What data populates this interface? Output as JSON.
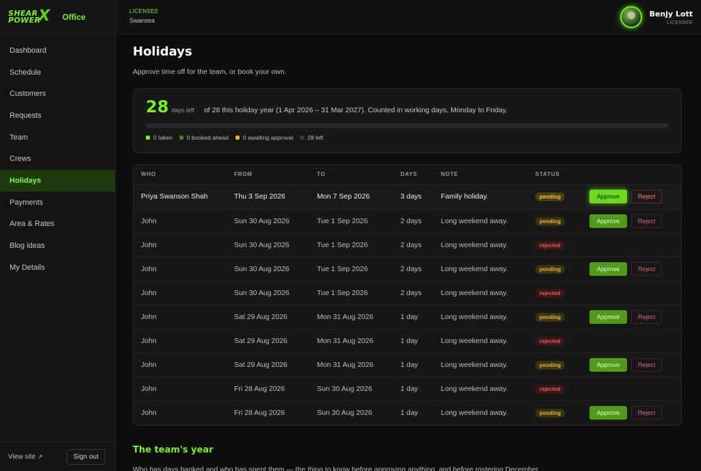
{
  "brand": {
    "line1": "SHEAR",
    "line2": "POWER",
    "x": "X",
    "office": "Office"
  },
  "topbar": {
    "licensee_label": "LICENSEE",
    "location": "Swansea",
    "user_name": "Benjy Lott",
    "user_role": "LICENSEE"
  },
  "nav": [
    {
      "label": "Dashboard",
      "active": false
    },
    {
      "label": "Schedule",
      "active": false
    },
    {
      "label": "Customers",
      "active": false
    },
    {
      "label": "Requests",
      "active": false
    },
    {
      "label": "Team",
      "active": false
    },
    {
      "label": "Crews",
      "active": false
    },
    {
      "label": "Holidays",
      "active": true
    },
    {
      "label": "Payments",
      "active": false
    },
    {
      "label": "Area & Rates",
      "active": false
    },
    {
      "label": "Blog ideas",
      "active": false
    },
    {
      "label": "My Details",
      "active": false
    }
  ],
  "footer": {
    "view_site": "View site",
    "view_site_icon": "↗",
    "sign_out": "Sign out"
  },
  "page": {
    "title": "Holidays",
    "subtitle": "Approve time off for the team, or book your own."
  },
  "balance": {
    "days_left": "28",
    "unit": "days left",
    "description": "of 28 this holiday year (1 Apr 2026 – 31 Mar 2027). Counted in working days, Monday to Friday.",
    "progress_used_fraction": 0,
    "legend": [
      {
        "label": "0 taken",
        "color": "#7cf21c"
      },
      {
        "label": "0 booked ahead",
        "color": "#3f8a14"
      },
      {
        "label": "0 awaiting approval",
        "color": "#e9b52c"
      },
      {
        "label": "28 left",
        "color": "#3a3a3a"
      }
    ]
  },
  "table": {
    "headers": {
      "who": "WHO",
      "from": "FROM",
      "to": "TO",
      "days": "DAYS",
      "note": "NOTE",
      "status": "STATUS"
    },
    "approve_label": "Approve",
    "reject_label": "Reject",
    "rows": [
      {
        "who": "Priya Swanson Shah",
        "from": "Thu 3 Sep 2026",
        "to": "Mon 7 Sep 2026",
        "days": "3 days",
        "note": "Family holiday.",
        "status": "pending"
      },
      {
        "who": "John",
        "from": "Sun 30 Aug 2026",
        "to": "Tue 1 Sep 2026",
        "days": "2 days",
        "note": "Long weekend away.",
        "status": "pending"
      },
      {
        "who": "John",
        "from": "Sun 30 Aug 2026",
        "to": "Tue 1 Sep 2026",
        "days": "2 days",
        "note": "Long weekend away.",
        "status": "rejected"
      },
      {
        "who": "John",
        "from": "Sun 30 Aug 2026",
        "to": "Tue 1 Sep 2026",
        "days": "2 days",
        "note": "Long weekend away.",
        "status": "pending"
      },
      {
        "who": "John",
        "from": "Sun 30 Aug 2026",
        "to": "Tue 1 Sep 2026",
        "days": "2 days",
        "note": "Long weekend away.",
        "status": "rejected"
      },
      {
        "who": "John",
        "from": "Sat 29 Aug 2026",
        "to": "Mon 31 Aug 2026",
        "days": "1 day",
        "note": "Long weekend away.",
        "status": "pending"
      },
      {
        "who": "John",
        "from": "Sat 29 Aug 2026",
        "to": "Mon 31 Aug 2026",
        "days": "1 day",
        "note": "Long weekend away.",
        "status": "rejected"
      },
      {
        "who": "John",
        "from": "Sat 29 Aug 2026",
        "to": "Mon 31 Aug 2026",
        "days": "1 day",
        "note": "Long weekend away.",
        "status": "pending"
      },
      {
        "who": "John",
        "from": "Fri 28 Aug 2026",
        "to": "Sun 30 Aug 2026",
        "days": "1 day",
        "note": "Long weekend away.",
        "status": "rejected"
      },
      {
        "who": "John",
        "from": "Fri 28 Aug 2026",
        "to": "Sun 30 Aug 2026",
        "days": "1 day",
        "note": "Long weekend away.",
        "status": "pending"
      }
    ]
  },
  "team_year": {
    "title": "The team's year",
    "description": "Who has days banked and who has spent them — the thing to know before approving anything, and before rostering December."
  }
}
